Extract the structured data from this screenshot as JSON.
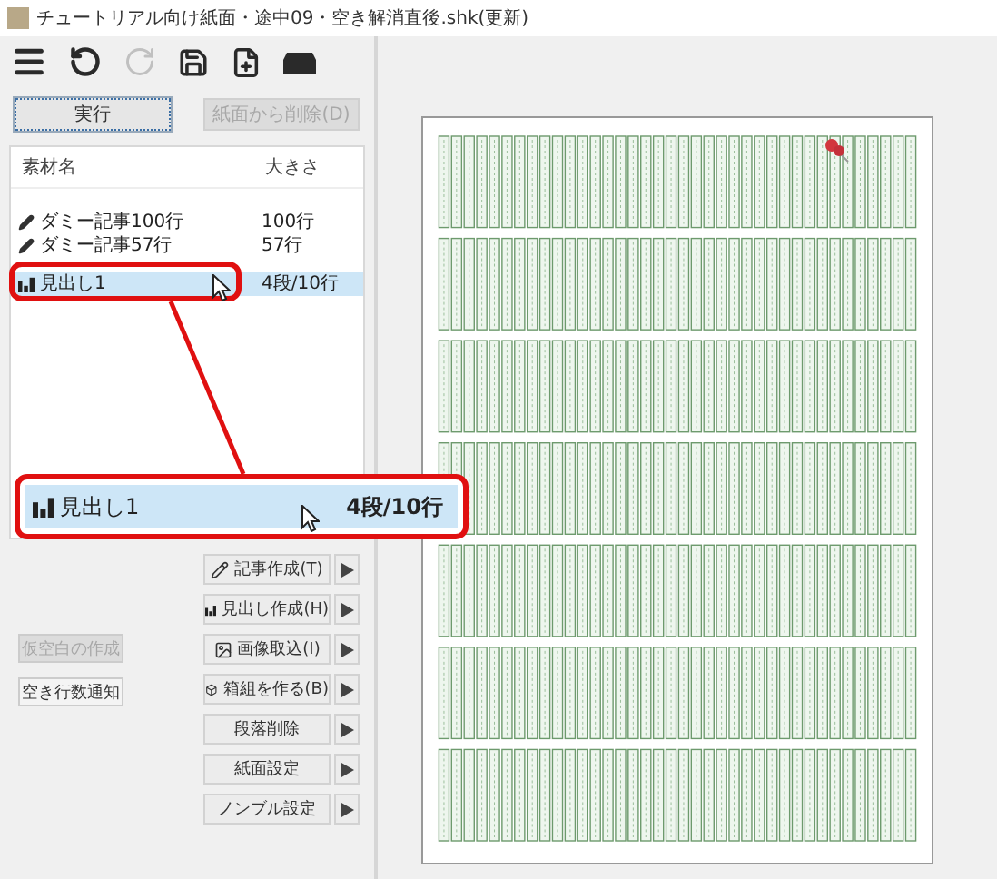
{
  "window": {
    "title": "チュートリアル向け紙面・途中09・空き解消直後.shk(更新)"
  },
  "toolbar": [
    {
      "kind": "menu",
      "disabled": false
    },
    {
      "kind": "undo",
      "disabled": false
    },
    {
      "kind": "redo",
      "disabled": true
    },
    {
      "kind": "save",
      "disabled": false
    },
    {
      "kind": "new",
      "disabled": false
    },
    {
      "kind": "open",
      "disabled": false
    }
  ],
  "top_buttons": [
    {
      "label": "実行",
      "disabled": false,
      "focused": true
    },
    {
      "label": "紙面から削除(D)",
      "disabled": true,
      "focused": false
    }
  ],
  "list": {
    "columns": [
      "素材名",
      "大きさ"
    ],
    "rows": [
      {
        "kind": "article",
        "name": "ダミー記事100行",
        "size": "100行",
        "selected": false
      },
      {
        "kind": "article",
        "name": "ダミー記事57行",
        "size": "57行",
        "selected": false
      },
      {
        "kind": "heading",
        "name": "見出し1",
        "size": "4段/10行",
        "selected": true
      }
    ]
  },
  "callout": {
    "kind": "heading",
    "name": "見出し1",
    "size": "4段/10行",
    "selected": true
  },
  "side_buttons": [
    {
      "label": "仮空白の作成",
      "disabled": true
    },
    {
      "label": "空き行数通知",
      "disabled": false
    }
  ],
  "action_buttons": [
    {
      "kind": "pencil",
      "label": "記事作成(T)"
    },
    {
      "kind": "heading",
      "label": "見出し作成(H)"
    },
    {
      "kind": "image",
      "label": "画像取込(I)"
    },
    {
      "kind": "box",
      "label": "箱組を作る(B)"
    },
    {
      "kind": "plain",
      "label": "段落削除"
    },
    {
      "kind": "plain",
      "label": "紙面設定"
    },
    {
      "kind": "plain",
      "label": "ノンブル設定"
    }
  ]
}
